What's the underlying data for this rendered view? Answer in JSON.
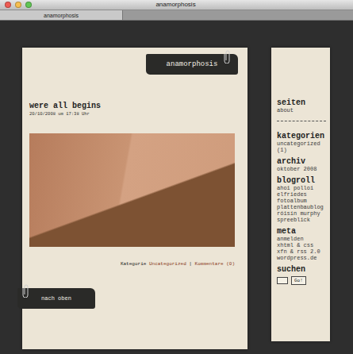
{
  "window": {
    "title": "anamorphosis"
  },
  "tabs": [
    {
      "label": "anamorphosis",
      "selected": true
    }
  ],
  "blog": {
    "name": "anamorphosis"
  },
  "post": {
    "title": "were all begins",
    "date": "20/10/2008 um 17:38 Uhr",
    "meta": {
      "category_label": "Kategorie",
      "category": "Uncategorized",
      "separator": "|",
      "comments": "Kommentare (0)"
    }
  },
  "back_to_top": "nach oben",
  "sidebar": {
    "sections": [
      {
        "heading": "seiten",
        "items": [
          "about"
        ],
        "divider": true
      },
      {
        "heading": "kategorien",
        "items": [
          "uncategorized (1)"
        ],
        "divider": false
      },
      {
        "heading": "archiv",
        "items": [
          "oktober 2008"
        ],
        "divider": false
      },
      {
        "heading": "blogroll",
        "items": [
          "ahoi polloi",
          "elfriedes fotoalbum",
          "plattenbaublog",
          "róisín murphy",
          "spreeblick"
        ],
        "divider": false
      },
      {
        "heading": "meta",
        "items": [
          "anmelden",
          "xhtml & css",
          "xfn & rss 2.0",
          "wordpress.de"
        ],
        "divider": false
      }
    ],
    "search": {
      "heading": "suchen",
      "value": "",
      "button": "Go!"
    }
  }
}
